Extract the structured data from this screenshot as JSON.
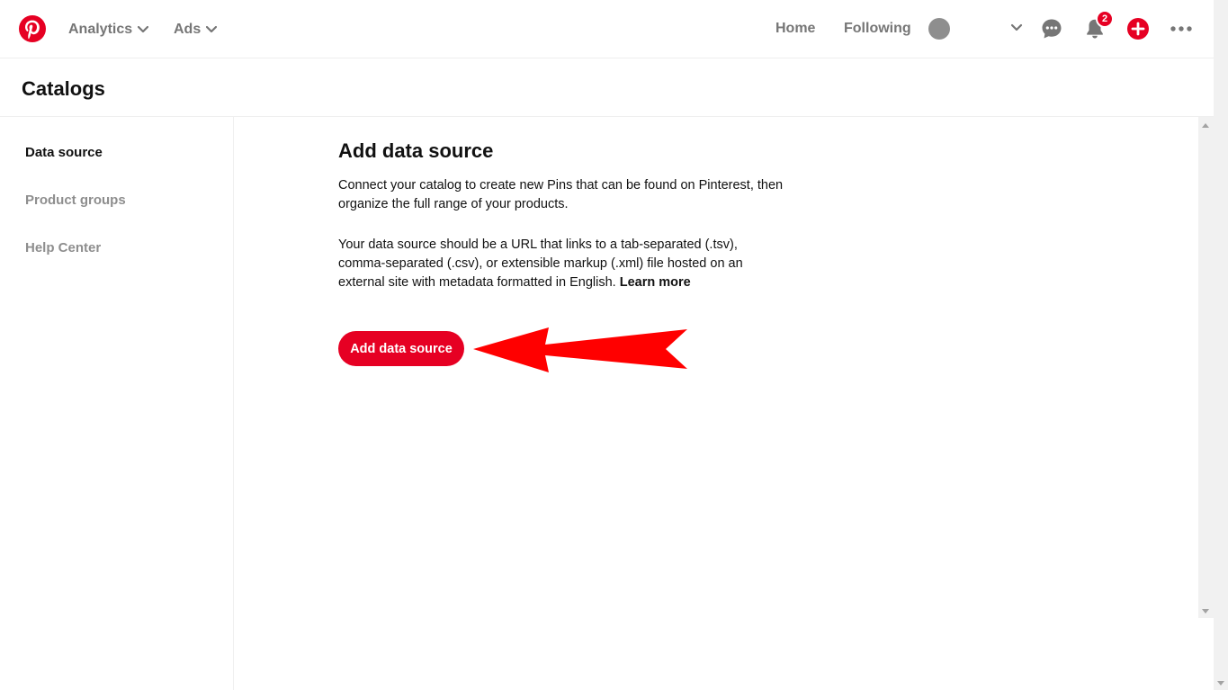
{
  "nav": {
    "analytics_label": "Analytics",
    "ads_label": "Ads",
    "home_label": "Home",
    "following_label": "Following",
    "notification_count": "2"
  },
  "header": {
    "title": "Catalogs"
  },
  "sidebar": {
    "items": [
      {
        "label": "Data source",
        "active": true
      },
      {
        "label": "Product groups",
        "active": false
      },
      {
        "label": "Help Center",
        "active": false
      }
    ]
  },
  "main": {
    "heading": "Add data source",
    "paragraph1": "Connect your catalog to create new Pins that can be found on Pinterest, then organize the full range of your products.",
    "paragraph2": "Your data source should be a URL that links to a tab-separated (.tsv), comma-separated (.csv), or extensible markup (.xml) file hosted on an external site with metadata formatted in English.",
    "learn_more": "Learn more",
    "button_label": "Add data source"
  },
  "colors": {
    "brand": "#e60023",
    "annotation_arrow": "#ff0000",
    "muted_text": "#767676"
  },
  "icons": {
    "logo": "pinterest-logo",
    "chevron": "chevron-down-icon",
    "messages": "speech-bubble-icon",
    "notifications": "bell-icon",
    "create": "plus-icon",
    "more": "ellipsis-icon"
  }
}
